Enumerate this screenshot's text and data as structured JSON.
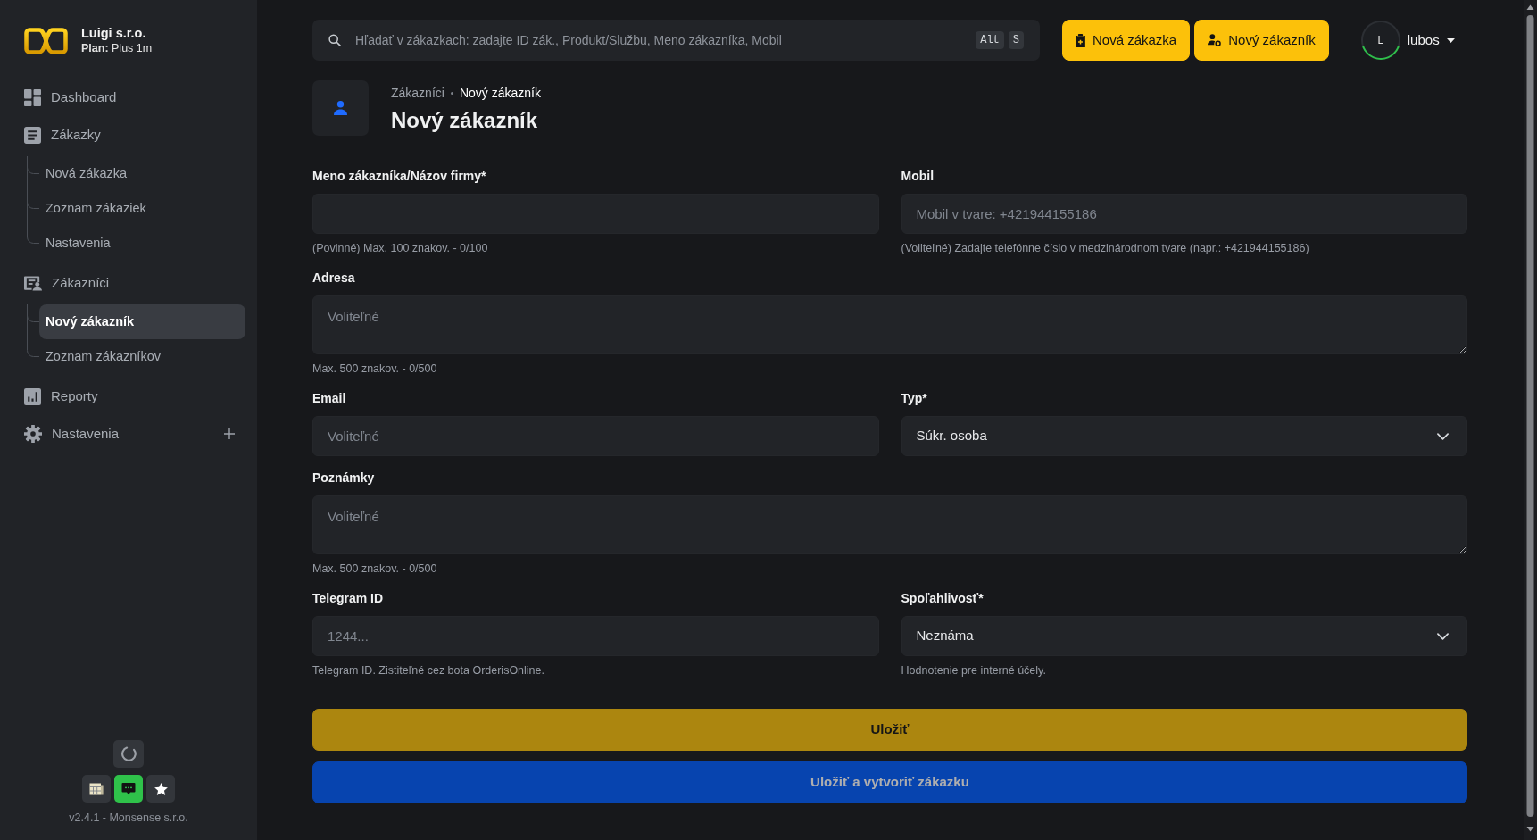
{
  "sidebar": {
    "brand": {
      "name": "Luigi s.r.o.",
      "plan": "**Plan:** Plus 1m"
    },
    "nav": [
      {
        "kind": "link",
        "label": "Dashboard",
        "selected": false
      },
      {
        "kind": "group",
        "label": "Zákazky",
        "selected": false,
        "expanded": true,
        "children": [
          {
            "label": "Nová zákazka",
            "selected": false
          },
          {
            "label": "Zoznam zákaziek",
            "selected": false
          },
          {
            "label": "Nastavenia",
            "selected": false
          }
        ]
      },
      {
        "kind": "group",
        "label": "Zákazníci",
        "selected": false,
        "expanded": true,
        "children": [
          {
            "label": "Nový zákazník",
            "selected": true
          },
          {
            "label": "Zoznam zákazníkov",
            "selected": false
          }
        ]
      },
      {
        "kind": "link",
        "label": "Reporty",
        "selected": false
      },
      {
        "kind": "group",
        "label": "Nastavenia",
        "selected": false,
        "expanded": false
      }
    ],
    "footer": {
      "version": "v2.4.1 - Monsense s.r.o."
    }
  },
  "topbar": {
    "search": {
      "placeholder": "Hľadať v zákazkach: zadajte ID zák., Produkt/Službu, Meno zákazníka, Mobil",
      "shortcut_keys": [
        "Alt",
        "S"
      ]
    },
    "actions": [
      {
        "label": "Nová zákazka"
      },
      {
        "label": "Nový zákazník"
      }
    ],
    "user": {
      "initial": "L",
      "name": "lubos"
    }
  },
  "page": {
    "breadcrumb": [
      {
        "label": "Zákazníci",
        "current": false
      },
      {
        "label": "Nový zákazník",
        "current": true
      }
    ],
    "title": "Nový zákazník",
    "form": {
      "rows": [
        {
          "fields": [
            {
              "kind": "input",
              "label": "Meno zákazníka/Názov firmy*",
              "help": "(Povinné) Max. 100 znakov. - 0/100"
            },
            {
              "kind": "input",
              "label": "Mobil",
              "placeholder": "Mobil v tvare: +421944155186",
              "help": "(Voliteľné) Zadajte telefónne číslo v medzinárodnom tvare (napr.: +421944155186)"
            }
          ]
        },
        {
          "fields": [
            {
              "kind": "textarea",
              "label": "Adresa",
              "placeholder": "Voliteľné",
              "help": "Max. 500 znakov. - 0/500"
            }
          ]
        },
        {
          "fields": [
            {
              "kind": "input",
              "label": "Email",
              "placeholder": "Voliteľné"
            },
            {
              "kind": "select",
              "label": "Typ*",
              "value": "Súkr. osoba"
            }
          ]
        },
        {
          "fields": [
            {
              "kind": "textarea",
              "label": "Poznámky",
              "placeholder": "Voliteľné",
              "help": "Max. 500 znakov. - 0/500"
            }
          ]
        },
        {
          "fields": [
            {
              "kind": "input",
              "label": "Telegram ID",
              "placeholder": "1244...",
              "help": "Telegram ID. Zistiteľné cez bota OrderisOnline."
            },
            {
              "kind": "select",
              "label": "Spoľahlivosť*",
              "value": "Neznáma",
              "help": "Hodnotenie pre interné účely."
            }
          ]
        }
      ],
      "buttons": [
        {
          "kind": "save",
          "label": "Uložiť",
          "disabled": true
        },
        {
          "kind": "create",
          "label": "Uložiť a vytvoriť zákazku",
          "disabled": true
        }
      ]
    }
  }
}
